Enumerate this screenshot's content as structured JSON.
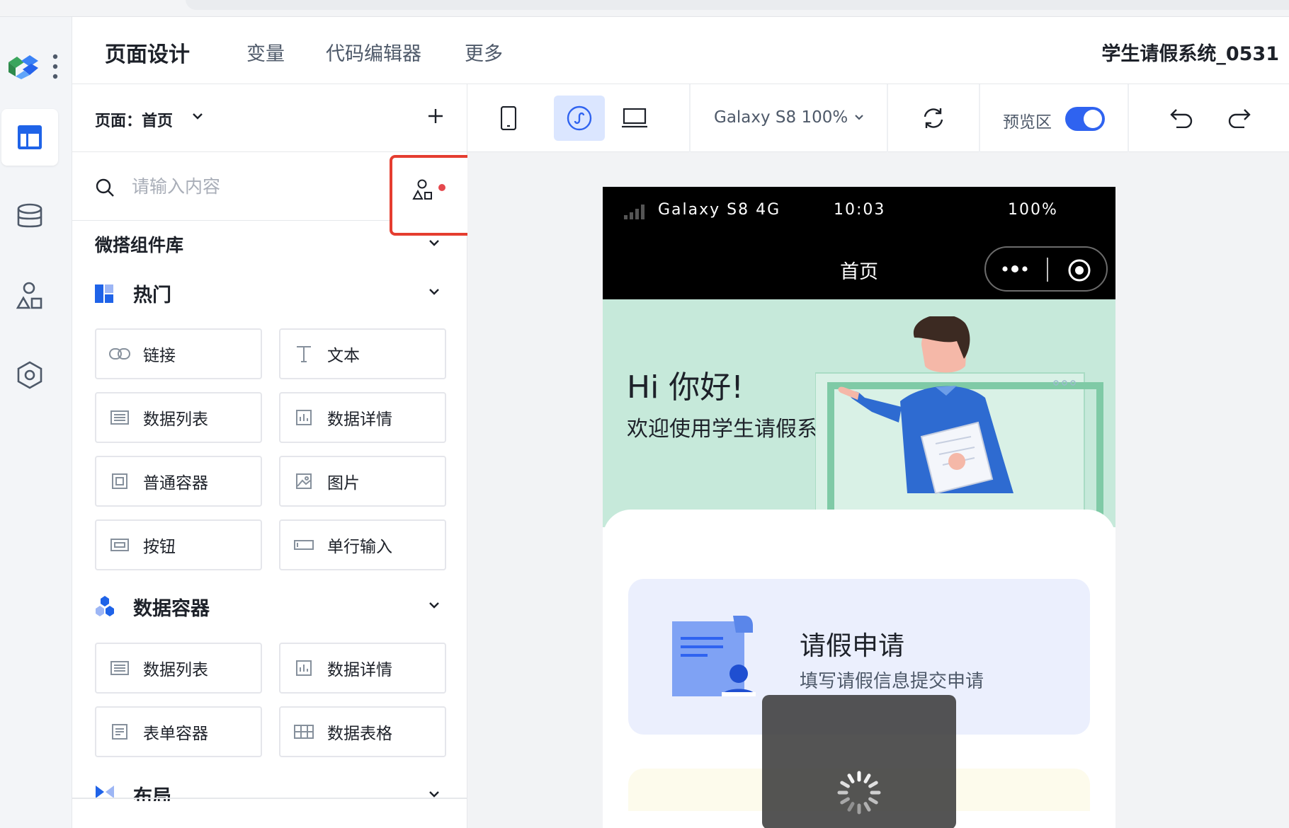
{
  "header": {
    "tabs": [
      {
        "label": "页面设计",
        "active": true
      },
      {
        "label": "变量"
      },
      {
        "label": "代码编辑器"
      },
      {
        "label": "更多"
      }
    ],
    "app_title": "学生请假系统_0531"
  },
  "rail": {
    "items": [
      "layout-icon",
      "database-icon",
      "components-icon",
      "settings-hexagon-icon"
    ],
    "active": "layout-icon"
  },
  "panel": {
    "page_selector": "页面：首页",
    "search_placeholder": "请输入内容",
    "library_title": "微搭组件库",
    "groups": [
      {
        "title": "热门",
        "items": [
          "链接",
          "文本",
          "数据列表",
          "数据详情",
          "普通容器",
          "图片",
          "按钮",
          "单行输入"
        ]
      },
      {
        "title": "数据容器",
        "items": [
          "数据列表",
          "数据详情",
          "表单容器",
          "数据表格"
        ]
      },
      {
        "title": "布局",
        "items": []
      }
    ]
  },
  "toolbar": {
    "device": "Galaxy S8 100%",
    "preview_label": "预览区",
    "preview_enabled": true,
    "active_view": "mini-program"
  },
  "phone": {
    "status": {
      "carrier": "Galaxy S8  4G",
      "time": "10:03",
      "battery": "100%"
    },
    "nav_title": "首页",
    "banner": {
      "greeting": "Hi 你好!",
      "welcome": "欢迎使用学生请假系统"
    },
    "card": {
      "title": "请假申请",
      "subtitle": "填写请假信息提交申请"
    }
  },
  "colors": {
    "accent": "#2f63f0",
    "highlight": "#e53d30",
    "banner": "#c6e9da",
    "card": "#ebeffd"
  }
}
